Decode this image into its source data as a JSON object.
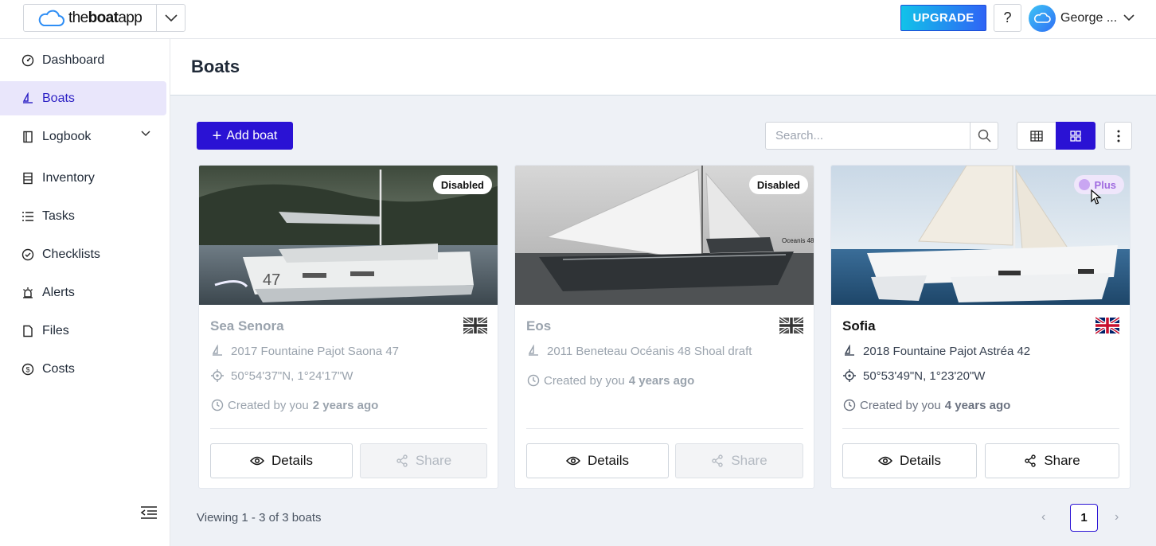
{
  "brand": {
    "text_light": "the",
    "text_bold": "boat",
    "text_tail": "app"
  },
  "header": {
    "upgrade_label": "UPGRADE",
    "help_label": "?",
    "user_name": "George ..."
  },
  "sidebar": {
    "items": [
      {
        "label": "Dashboard",
        "icon": "dashboard-icon"
      },
      {
        "label": "Boats",
        "icon": "sailboat-icon",
        "active": true
      },
      {
        "label": "Logbook",
        "icon": "book-icon",
        "expandable": true
      },
      {
        "label": "Inventory",
        "icon": "inventory-icon"
      },
      {
        "label": "Tasks",
        "icon": "list-icon"
      },
      {
        "label": "Checklists",
        "icon": "check-circle-icon"
      },
      {
        "label": "Alerts",
        "icon": "alarm-icon"
      },
      {
        "label": "Files",
        "icon": "file-icon"
      },
      {
        "label": "Costs",
        "icon": "dollar-icon"
      }
    ]
  },
  "page": {
    "title": "Boats"
  },
  "toolbar": {
    "add_label": "Add boat",
    "search_placeholder": "Search..."
  },
  "colors": {
    "accent": "#2a12d4",
    "active_bg": "#e9e6fb",
    "plus_badge": "#a06be0"
  },
  "boats": [
    {
      "name": "Sea Senora",
      "badge": "Disabled",
      "model": "2017 Fountaine Pajot Saona 47",
      "location": "50°54'37\"N, 1°24'17\"W",
      "created_prefix": "Created by you",
      "created_when": "2 years ago",
      "flag": "uk-flag-grey",
      "details_label": "Details",
      "share_label": "Share",
      "share_enabled": false,
      "hull_number": "47"
    },
    {
      "name": "Eos",
      "badge": "Disabled",
      "model": "2011 Beneteau Océanis 48 Shoal draft",
      "created_prefix": "Created by you",
      "created_when": "4 years ago",
      "flag": "uk-flag-grey",
      "details_label": "Details",
      "share_label": "Share",
      "share_enabled": false,
      "image_caption": "Oceanis 48"
    },
    {
      "name": "Sofia",
      "badge": "Plus",
      "model": "2018 Fountaine Pajot Astréa 42",
      "location": "50°53'49\"N, 1°23'20\"W",
      "created_prefix": "Created by you",
      "created_when": "4 years ago",
      "flag": "uk-flag-color",
      "details_label": "Details",
      "share_label": "Share",
      "share_enabled": true
    }
  ],
  "pagination": {
    "summary": "Viewing 1 - 3 of 3 boats",
    "current_page": "1",
    "prev": "‹",
    "next": "›"
  }
}
